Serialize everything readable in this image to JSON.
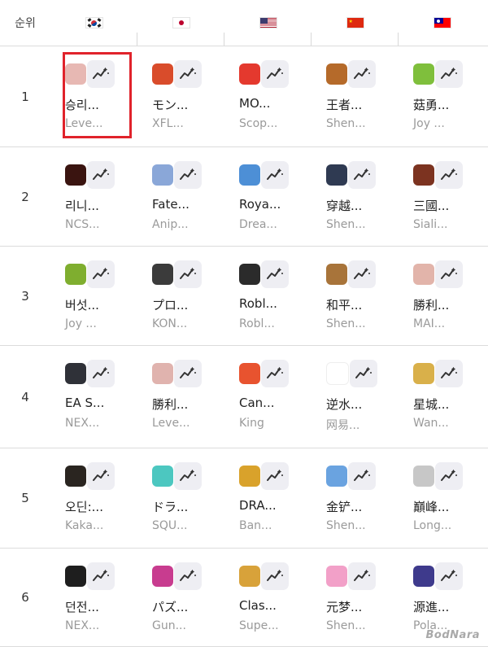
{
  "header": {
    "rank_label": "순위",
    "countries": [
      {
        "id": "kr",
        "icon": "south-korea-flag-icon"
      },
      {
        "id": "jp",
        "icon": "japan-flag-icon"
      },
      {
        "id": "us",
        "icon": "usa-flag-icon"
      },
      {
        "id": "cn",
        "icon": "china-flag-icon"
      },
      {
        "id": "tw",
        "icon": "taiwan-flag-icon"
      }
    ]
  },
  "colors": {
    "highlight": "#e0232b",
    "divider": "#dcdcdc",
    "trend_bg": "#eeeef3",
    "developer_text": "#9a9a9a"
  },
  "rows": [
    {
      "rank": "1",
      "apps": [
        {
          "name": "승리...",
          "developer": "Leve...",
          "icon_color": "#e7b8b3",
          "icon_name": "anime-girl-app-icon"
        },
        {
          "name": "モン...",
          "developer": "XFL...",
          "icon_color": "#d94c2b",
          "icon_name": "monster-strike-app-icon"
        },
        {
          "name": "MO...",
          "developer": "Scop...",
          "icon_color": "#e4392e",
          "icon_name": "monopoly-go-app-icon"
        },
        {
          "name": "王者...",
          "developer": "Shen...",
          "icon_color": "#b56a2a",
          "icon_name": "honor-of-kings-app-icon"
        },
        {
          "name": "菇勇...",
          "developer": "Joy ...",
          "icon_color": "#7fbf3c",
          "icon_name": "mushroom-game-app-icon"
        }
      ]
    },
    {
      "rank": "2",
      "apps": [
        {
          "name": "리니...",
          "developer": "NCS...",
          "icon_color": "#3a1410",
          "icon_name": "lineage-m-app-icon"
        },
        {
          "name": "Fate...",
          "developer": "Anip...",
          "icon_color": "#8aa7d8",
          "icon_name": "fate-grand-order-app-icon"
        },
        {
          "name": "Roya...",
          "developer": "Drea...",
          "icon_color": "#4d8fd6",
          "icon_name": "royal-match-app-icon"
        },
        {
          "name": "穿越...",
          "developer": "Shen...",
          "icon_color": "#2f3a52",
          "icon_name": "crossfire-app-icon"
        },
        {
          "name": "三國...",
          "developer": "Siali...",
          "icon_color": "#7c3320",
          "icon_name": "three-kingdoms-app-icon"
        }
      ]
    },
    {
      "rank": "3",
      "apps": [
        {
          "name": "버섯...",
          "developer": "Joy ...",
          "icon_color": "#7fae2f",
          "icon_name": "mushroom-game-app-icon"
        },
        {
          "name": "プロ...",
          "developer": "KON...",
          "icon_color": "#3b3b3b",
          "icon_name": "pro-baseball-app-icon"
        },
        {
          "name": "Robl...",
          "developer": "Robl...",
          "icon_color": "#2b2b2b",
          "icon_name": "roblox-app-icon"
        },
        {
          "name": "和平...",
          "developer": "Shen...",
          "icon_color": "#a8743a",
          "icon_name": "peacekeeper-elite-app-icon"
        },
        {
          "name": "勝利...",
          "developer": "MAI...",
          "icon_color": "#e2b4aa",
          "icon_name": "anime-girl-app-icon"
        }
      ]
    },
    {
      "rank": "4",
      "apps": [
        {
          "name": "EA S...",
          "developer": "NEX...",
          "icon_color": "#2f3138",
          "icon_name": "ea-sports-fc-app-icon"
        },
        {
          "name": "勝利...",
          "developer": "Leve...",
          "icon_color": "#e0b3ae",
          "icon_name": "anime-girl-app-icon"
        },
        {
          "name": "Can...",
          "developer": "King",
          "icon_color": "#e8532f",
          "icon_name": "candy-crush-app-icon"
        },
        {
          "name": "逆水...",
          "developer": "网易...",
          "icon_color": "#ffffff",
          "icon_name": "justice-calligraphy-app-icon"
        },
        {
          "name": "星城...",
          "developer": "Wan...",
          "icon_color": "#d9b04a",
          "icon_name": "star-city-app-icon"
        }
      ]
    },
    {
      "rank": "5",
      "apps": [
        {
          "name": "오딘:...",
          "developer": "Kaka...",
          "icon_color": "#2a2520",
          "icon_name": "odin-app-icon"
        },
        {
          "name": "ドラ...",
          "developer": "SQU...",
          "icon_color": "#4cc7c0",
          "icon_name": "dragon-quest-app-icon"
        },
        {
          "name": "DRA...",
          "developer": "Ban...",
          "icon_color": "#d9a22b",
          "icon_name": "dragon-ball-app-icon"
        },
        {
          "name": "金铲...",
          "developer": "Shen...",
          "icon_color": "#6aa3e0",
          "icon_name": "golden-spatula-app-icon"
        },
        {
          "name": "巔峰...",
          "developer": "Long...",
          "icon_color": "#c7c7c7",
          "icon_name": "racing-car-app-icon"
        }
      ]
    },
    {
      "rank": "6",
      "apps": [
        {
          "name": "던전...",
          "developer": "NEX...",
          "icon_color": "#1e1e1e",
          "icon_name": "dungeon-fighter-app-icon"
        },
        {
          "name": "パズ...",
          "developer": "Gun...",
          "icon_color": "#c83c8f",
          "icon_name": "puzzle-dragons-app-icon"
        },
        {
          "name": "Clas...",
          "developer": "Supe...",
          "icon_color": "#d8a23a",
          "icon_name": "clash-of-clans-app-icon"
        },
        {
          "name": "元梦...",
          "developer": "Shen...",
          "icon_color": "#f2a0c8",
          "icon_name": "dream-star-app-icon"
        },
        {
          "name": "源進...",
          "developer": "Pola...",
          "icon_color": "#3e3a8c",
          "icon_name": "anime-character-app-icon"
        }
      ]
    }
  ],
  "watermark": "BodNara"
}
